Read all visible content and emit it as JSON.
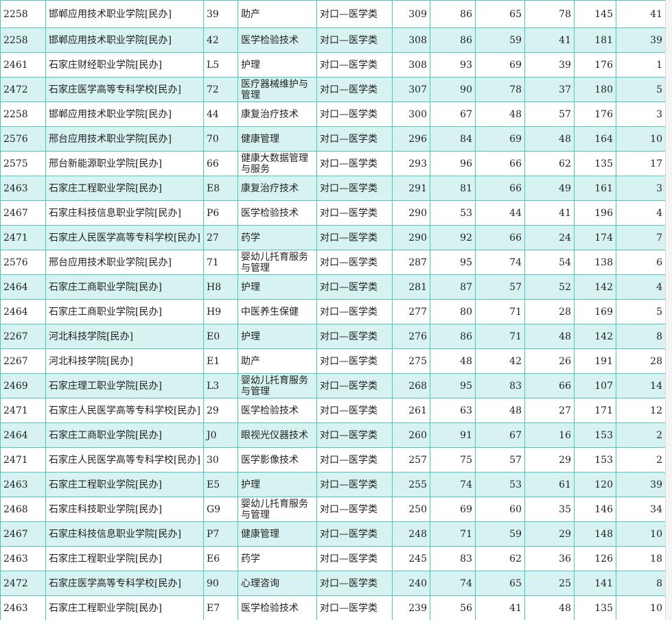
{
  "table": {
    "rows": [
      [
        "2258",
        "邯郸应用技术职业学院[民办]",
        "39",
        "助产",
        "对口—医学类",
        "309",
        "86",
        "65",
        "78",
        "145",
        "41"
      ],
      [
        "2258",
        "邯郸应用技术职业学院[民办]",
        "42",
        "医学检验技术",
        "对口—医学类",
        "308",
        "86",
        "59",
        "41",
        "181",
        "39"
      ],
      [
        "2461",
        "石家庄财经职业学院[民办]",
        "L5",
        "护理",
        "对口—医学类",
        "308",
        "93",
        "69",
        "39",
        "176",
        "1"
      ],
      [
        "2472",
        "石家庄医学高等专科学校[民办]",
        "72",
        "医疗器械维护与管理",
        "对口—医学类",
        "307",
        "90",
        "78",
        "37",
        "180",
        "5"
      ],
      [
        "2258",
        "邯郸应用技术职业学院[民办]",
        "44",
        "康复治疗技术",
        "对口—医学类",
        "300",
        "67",
        "48",
        "57",
        "176",
        "3"
      ],
      [
        "2576",
        "邢台应用技术职业学院[民办]",
        "70",
        "健康管理",
        "对口—医学类",
        "296",
        "84",
        "69",
        "48",
        "164",
        "10"
      ],
      [
        "2575",
        "邢台新能源职业学院[民办]",
        "66",
        "健康大数据管理与服务",
        "对口—医学类",
        "293",
        "96",
        "66",
        "62",
        "135",
        "17"
      ],
      [
        "2463",
        "石家庄工程职业学院[民办]",
        "E8",
        "康复治疗技术",
        "对口—医学类",
        "291",
        "81",
        "66",
        "49",
        "161",
        "3"
      ],
      [
        "2467",
        "石家庄科技信息职业学院[民办]",
        "P6",
        "医学检验技术",
        "对口—医学类",
        "290",
        "53",
        "44",
        "41",
        "196",
        "4"
      ],
      [
        "2471",
        "石家庄人民医学高等专科学校[民办]",
        "27",
        "药学",
        "对口—医学类",
        "290",
        "92",
        "66",
        "24",
        "174",
        "7"
      ],
      [
        "2576",
        "邢台应用技术职业学院[民办]",
        "71",
        "婴幼儿托育服务与管理",
        "对口—医学类",
        "287",
        "95",
        "74",
        "54",
        "138",
        "6"
      ],
      [
        "2464",
        "石家庄工商职业学院[民办]",
        "H8",
        "护理",
        "对口—医学类",
        "281",
        "87",
        "57",
        "52",
        "142",
        "4"
      ],
      [
        "2464",
        "石家庄工商职业学院[民办]",
        "H9",
        "中医养生保健",
        "对口—医学类",
        "277",
        "80",
        "71",
        "28",
        "169",
        "5"
      ],
      [
        "2267",
        "河北科技学院[民办]",
        "E0",
        "护理",
        "对口—医学类",
        "276",
        "86",
        "71",
        "48",
        "142",
        "8"
      ],
      [
        "2267",
        "河北科技学院[民办]",
        "E1",
        "助产",
        "对口—医学类",
        "275",
        "48",
        "42",
        "26",
        "191",
        "28"
      ],
      [
        "2469",
        "石家庄理工职业学院[民办]",
        "L3",
        "婴幼儿托育服务与管理",
        "对口—医学类",
        "268",
        "95",
        "83",
        "66",
        "107",
        "14"
      ],
      [
        "2471",
        "石家庄人民医学高等专科学校[民办]",
        "29",
        "医学检验技术",
        "对口—医学类",
        "261",
        "63",
        "48",
        "27",
        "171",
        "12"
      ],
      [
        "2464",
        "石家庄工商职业学院[民办]",
        "J0",
        "眼视光仪器技术",
        "对口—医学类",
        "260",
        "91",
        "67",
        "16",
        "153",
        "2"
      ],
      [
        "2471",
        "石家庄人民医学高等专科学校[民办]",
        "30",
        "医学影像技术",
        "对口—医学类",
        "257",
        "75",
        "57",
        "29",
        "153",
        "2"
      ],
      [
        "2463",
        "石家庄工程职业学院[民办]",
        "E5",
        "护理",
        "对口—医学类",
        "255",
        "74",
        "53",
        "61",
        "120",
        "39"
      ],
      [
        "2468",
        "石家庄科技职业学院[民办]",
        "G9",
        "婴幼儿托育服务与管理",
        "对口—医学类",
        "250",
        "69",
        "60",
        "35",
        "146",
        "34"
      ],
      [
        "2467",
        "石家庄科技信息职业学院[民办]",
        "P7",
        "健康管理",
        "对口—医学类",
        "248",
        "71",
        "59",
        "29",
        "148",
        "10"
      ],
      [
        "2463",
        "石家庄工程职业学院[民办]",
        "E6",
        "药学",
        "对口—医学类",
        "245",
        "83",
        "62",
        "36",
        "126",
        "18"
      ],
      [
        "2472",
        "石家庄医学高等专科学校[民办]",
        "90",
        "心理咨询",
        "对口—医学类",
        "240",
        "74",
        "65",
        "25",
        "141",
        "8"
      ],
      [
        "2463",
        "石家庄工程职业学院[民办]",
        "E7",
        "医学检验技术",
        "对口—医学类",
        "239",
        "56",
        "41",
        "48",
        "135",
        "10"
      ]
    ]
  },
  "colors": {
    "border": "#52c4bc",
    "row_even": "#d7f3f1",
    "row_odd": "#ffffff",
    "text": "#1f1f1f"
  }
}
